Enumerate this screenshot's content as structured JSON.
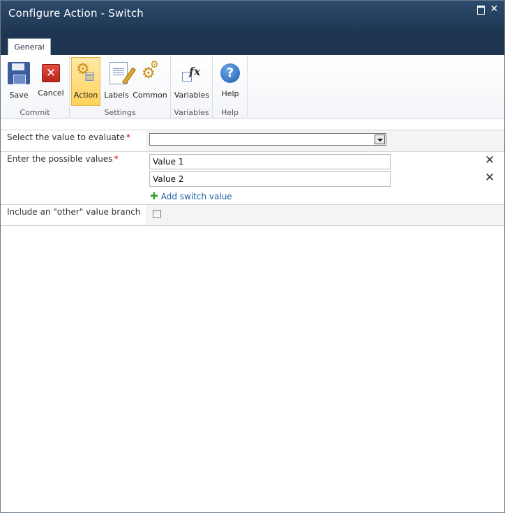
{
  "window": {
    "title": "Configure Action - Switch"
  },
  "tabs": [
    {
      "label": "General"
    }
  ],
  "ribbon": {
    "groups": [
      {
        "label": "Commit",
        "buttons": [
          {
            "label": "Save",
            "icon": "save-icon"
          },
          {
            "label": "Cancel",
            "icon": "cancel-icon"
          }
        ]
      },
      {
        "label": "Settings",
        "buttons": [
          {
            "label": "Action",
            "icon": "action-gears-icon",
            "selected": true
          },
          {
            "label": "Labels",
            "icon": "labels-icon"
          },
          {
            "label": "Common",
            "icon": "common-gears-icon"
          }
        ]
      },
      {
        "label": "Variables",
        "buttons": [
          {
            "label": "Variables",
            "icon": "variables-fx-icon"
          }
        ]
      },
      {
        "label": "Help",
        "buttons": [
          {
            "label": "Help",
            "icon": "help-icon"
          }
        ]
      }
    ]
  },
  "form": {
    "evaluate": {
      "label": "Select the value to evaluate",
      "required_mark": "*",
      "selected_value": ""
    },
    "possible_values": {
      "label": "Enter the possible values",
      "required_mark": "*",
      "values": [
        "Value 1",
        "Value 2"
      ],
      "remove_symbol": "✕",
      "add_link": "Add switch value",
      "add_symbol": "✚"
    },
    "other_branch": {
      "label": "Include an \"other\" value branch",
      "checked": false
    }
  },
  "colors": {
    "titlebar": "#1d3550",
    "selected_button": "#ffd35a",
    "link": "#1c5ea6",
    "required": "#cc0000"
  }
}
